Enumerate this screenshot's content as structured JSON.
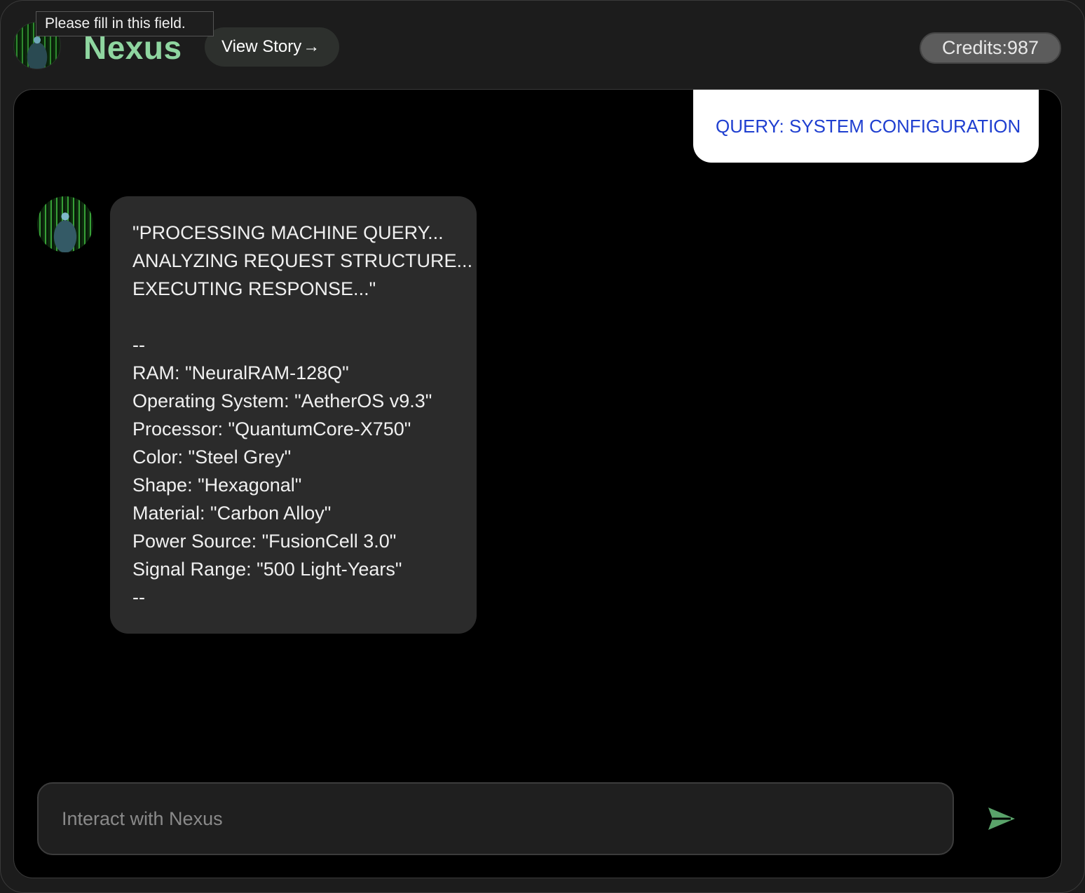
{
  "header": {
    "title": "Nexus",
    "view_story_label": "View Story",
    "view_story_icon": "arrow-right-icon",
    "credits_label": "Credits:",
    "credits_value": "987",
    "tooltip": "Please fill in this field."
  },
  "chat": {
    "user_message": "QUERY: SYSTEM CONFIGURATION",
    "bot_message_lines": [
      "\"PROCESSING MACHINE QUERY...",
      "ANALYZING REQUEST STRUCTURE...",
      "EXECUTING RESPONSE...\"",
      "",
      "--",
      "RAM: \"NeuralRAM-128Q\"",
      "Operating System: \"AetherOS v9.3\"",
      "Processor: \"QuantumCore-X750\"",
      "Color: \"Steel Grey\"",
      "Shape: \"Hexagonal\"",
      "Material: \"Carbon Alloy\"",
      "Power Source: \"FusionCell 3.0\"",
      "Signal Range: \"500 Light-Years\"",
      "--"
    ]
  },
  "composer": {
    "placeholder": "Interact with Nexus",
    "value": "",
    "send_icon": "send-icon"
  },
  "colors": {
    "brand_title": "#8fd6a0",
    "send_icon": "#5aa36a",
    "user_text": "#1f3fd0"
  }
}
